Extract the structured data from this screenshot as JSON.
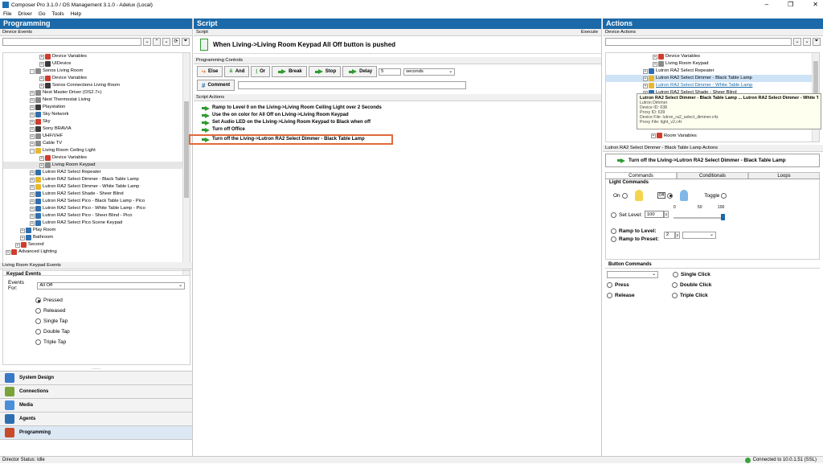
{
  "window": {
    "title": "Composer Pro 3.1.0 / OS Management 3.1.0 - Adelux (Local)",
    "min": "–",
    "max": "❐",
    "close": "✕"
  },
  "menu": [
    "File",
    "Driver",
    "Go",
    "Tools",
    "Help"
  ],
  "programming": {
    "title": "Programming",
    "device_events_label": "Device Events",
    "tree": [
      {
        "label": "Device Variables",
        "depth": 7,
        "exp": "+",
        "icon": "red"
      },
      {
        "label": "UIDevice",
        "depth": 7,
        "exp": "+",
        "icon": "dark"
      },
      {
        "label": "Sonos Living Room",
        "depth": 5,
        "exp": "-",
        "icon": "gray"
      },
      {
        "label": "Device Variables",
        "depth": 7,
        "exp": "+",
        "icon": "red"
      },
      {
        "label": "Sonos Connections Living Room",
        "depth": 7,
        "exp": "+",
        "icon": "dark"
      },
      {
        "label": "Nest Master Driver (OS2.7+)",
        "depth": 5,
        "exp": "+",
        "icon": "gray"
      },
      {
        "label": "Nest Thermostat Living",
        "depth": 5,
        "exp": "+",
        "icon": "gray"
      },
      {
        "label": "Playstation",
        "depth": 5,
        "exp": "+",
        "icon": "dark"
      },
      {
        "label": "Sky Network",
        "depth": 5,
        "exp": "+",
        "icon": "blue"
      },
      {
        "label": "Sky",
        "depth": 5,
        "exp": "+",
        "icon": "red"
      },
      {
        "label": "Sony BRAVIA",
        "depth": 5,
        "exp": "+",
        "icon": "dark"
      },
      {
        "label": "UHF/VHF",
        "depth": 5,
        "exp": "+",
        "icon": "gray"
      },
      {
        "label": "Cable TV",
        "depth": 5,
        "exp": "+",
        "icon": "gray"
      },
      {
        "label": "Living Room Ceiling Light",
        "depth": 5,
        "exp": "-",
        "icon": "yellow"
      },
      {
        "label": "Device Variables",
        "depth": 7,
        "exp": "+",
        "icon": "red"
      },
      {
        "label": "Living Room Keypad",
        "depth": 7,
        "exp": "+",
        "icon": "gray"
      },
      {
        "label": "Lutron RA2 Select Repeater",
        "depth": 5,
        "exp": "+",
        "icon": "blue"
      },
      {
        "label": "Lutron RA2 Select Dimmer - Black Table Lamp",
        "depth": 5,
        "exp": "+",
        "icon": "yellow"
      },
      {
        "label": "Lutron RA2 Select Dimmer - White Table Lamp",
        "depth": 5,
        "exp": "+",
        "icon": "yellow"
      },
      {
        "label": "Lutron RA2 Select Shade - Sheer Blind",
        "depth": 5,
        "exp": "+",
        "icon": "blue"
      },
      {
        "label": "Lutron RA2 Select Pico - Black Table Lamp - Pico",
        "depth": 5,
        "exp": "+",
        "icon": "blue"
      },
      {
        "label": "Lutron RA2 Select Pico - White Table Lamp - Pico",
        "depth": 5,
        "exp": "+",
        "icon": "blue"
      },
      {
        "label": "Lutron RA2 Select Pico - Sheer Blind - Pico",
        "depth": 5,
        "exp": "+",
        "icon": "blue"
      },
      {
        "label": "Lutron RA2 Select Pico Scene Keypad",
        "depth": 5,
        "exp": "+",
        "icon": "blue"
      },
      {
        "label": "Play Room",
        "depth": 3,
        "exp": "+",
        "icon": "blue"
      },
      {
        "label": "Bathroom",
        "depth": 3,
        "exp": "+",
        "icon": "blue"
      },
      {
        "label": "Second",
        "depth": 2,
        "exp": "+",
        "icon": "red"
      },
      {
        "label": "Advanced Lighting",
        "depth": 0,
        "exp": "+",
        "icon": "red"
      }
    ],
    "keypad_events_header": "Living Room Keypad Events",
    "keypad_events_title": "Keypad Events",
    "events_for_label": "Events For:",
    "events_for_value": "All Off",
    "events": [
      {
        "label": "Pressed",
        "on": true
      },
      {
        "label": "Released",
        "on": false
      },
      {
        "label": "Single Tap",
        "on": false
      },
      {
        "label": "Double Tap",
        "on": false
      },
      {
        "label": "Triple Tap",
        "on": false
      }
    ],
    "splitter": "........",
    "nav": [
      {
        "label": "System Design",
        "color": "#3a78c8"
      },
      {
        "label": "Connections",
        "color": "#7aa33a"
      },
      {
        "label": "Media",
        "color": "#4a90d9"
      },
      {
        "label": "Agents",
        "color": "#2f6fb0"
      },
      {
        "label": "Programming",
        "color": "#c84a2a"
      }
    ]
  },
  "script": {
    "title": "Script",
    "script_label": "Script",
    "execute": "Execute",
    "when_text": "When Living->Living Room Keypad All Off button is pushed",
    "controls_label": "Programming Controls",
    "buttons": [
      "Else",
      "And",
      "Or",
      "Break",
      "Stop",
      "Delay"
    ],
    "delay_value": "5",
    "delay_unit": "seconds",
    "comment_label": "Comment",
    "actions_label": "Script Actions",
    "actions": [
      "Ramp to Level 0 on the Living->Living Room Ceiling Light over 2 Seconds",
      "Use the on color for All Off on Living->Living Room Keypad",
      "Set Audio LED on the Living->Living Room Keypad to Black when off",
      "Turn off Office",
      "Turn off the Living->Lutron RA2 Select Dimmer - Black Table Lamp"
    ]
  },
  "actions_panel": {
    "title": "Actions",
    "device_actions_label": "Device Actions",
    "tree": [
      {
        "label": "Device Variables",
        "depth": 5,
        "icon": "red"
      },
      {
        "label": "Living Room Keypad",
        "depth": 5,
        "icon": "gray"
      },
      {
        "label": "Lutron RA2 Select Repeater",
        "depth": 3,
        "icon": "blue"
      },
      {
        "label": "Lutron RA2 Select Dimmer - Black Table Lamp",
        "depth": 3,
        "icon": "yellow"
      },
      {
        "label": "Lutron RA2 Select Dimmer - White Table Lamp",
        "depth": 3,
        "icon": "yellow"
      },
      {
        "label": "Lutron RA2 Select Shade - Sheer Blind",
        "depth": 3,
        "icon": "blue"
      }
    ],
    "tooltip": {
      "title": "Lutron RA2 Select Dimmer - Black Table Lamp ... Lutron RA2 Select Dimmer - White Table Lamp",
      "lines": [
        "Lutron Dimmer",
        "Device ID: 638",
        "Proxy ID: 639",
        "Device File: lutron_ra2_select_dimmer.c4z",
        "Proxy File: light_v2.c4i"
      ]
    },
    "room_variables": "Room Variables",
    "selected_header": "Lutron RA2 Select Dimmer - Black Table Lamp Actions",
    "selected_action": "Turn off the Living->Lutron RA2 Select Dimmer - Black Table Lamp",
    "tabs": [
      "Commands",
      "Conditionals",
      "Loops"
    ],
    "light_commands": "Light Commands",
    "on": "On",
    "toggle": "Toggle",
    "set_level": "Set Level:",
    "set_level_value": "100",
    "slider_ticks": [
      "0",
      "50",
      "100"
    ],
    "slider_value": 100,
    "ramp_level": "Ramp to Level:",
    "ramp_preset": "Ramp to Preset:",
    "ramp_value": "2",
    "button_commands": "Button Commands",
    "single_click": "Single Click",
    "press": "Press",
    "double_click": "Double Click",
    "release": "Release",
    "triple_click": "Triple Click"
  },
  "status": {
    "left": "Director Status: Idle",
    "right": "Connected to 10.0.1.51 (SSL)"
  }
}
